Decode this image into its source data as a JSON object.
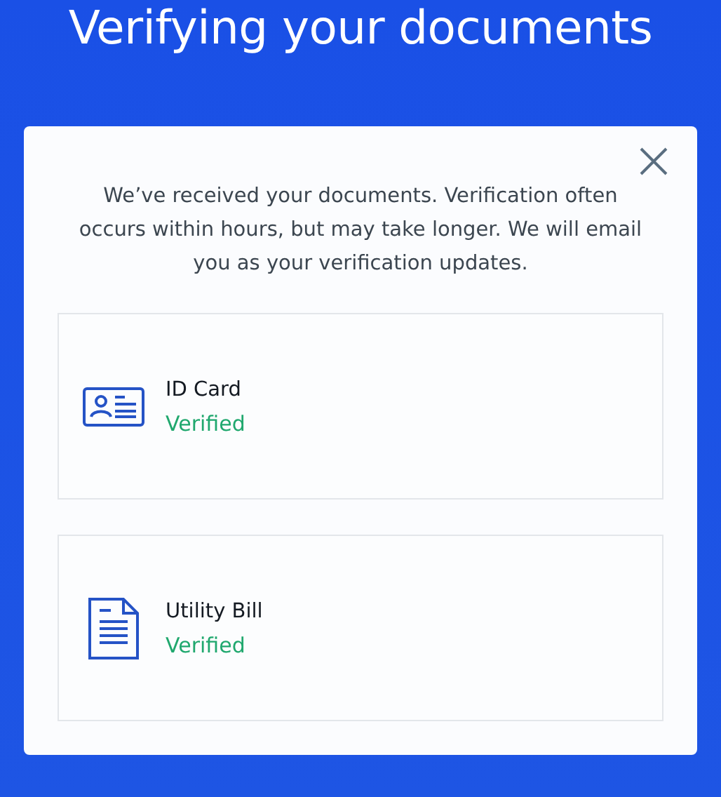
{
  "title": "Verifying your documents",
  "modal": {
    "message": "We’ve received your documents. Verification often occurs within hours, but may take longer. We will email you as your verification updates.",
    "documents": [
      {
        "kind": "id_card",
        "name": "ID Card",
        "status": "Verified",
        "verified": true
      },
      {
        "kind": "bill",
        "name": "Utility Bill",
        "status": "Verified",
        "verified": true
      }
    ]
  }
}
